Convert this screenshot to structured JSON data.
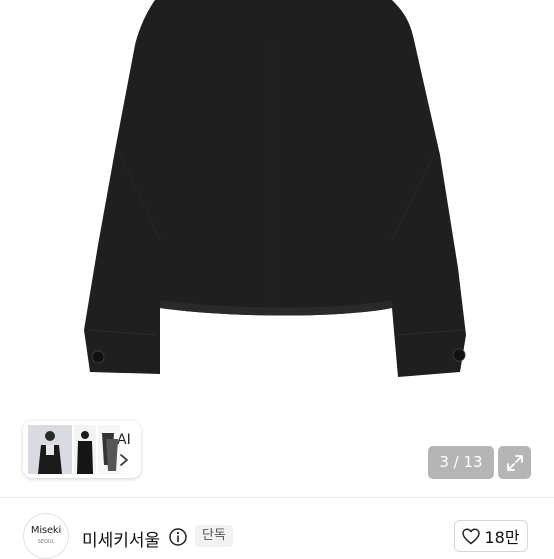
{
  "gallery": {
    "counter": "3 / 13",
    "ai_label": "AI"
  },
  "shop": {
    "logo_text": "Miseki",
    "logo_subtext": "SEOUL",
    "name": "미세키서울",
    "badge": "단독",
    "likes": "18만"
  },
  "icons": [
    "info-icon",
    "heart-icon",
    "expand-icon",
    "chevron-right-icon"
  ],
  "colors": {
    "garment": "#1e1e1e",
    "overlay": "#787878"
  }
}
